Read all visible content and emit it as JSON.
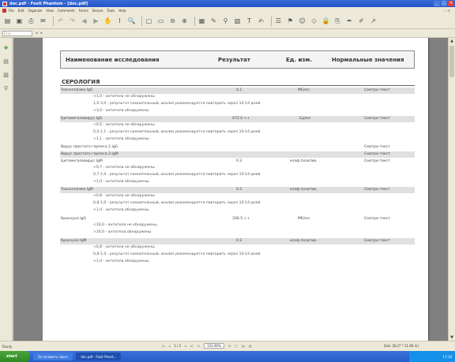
{
  "window": {
    "title": "doc.pdf - Foxit Phantom - [doc.pdf]"
  },
  "menu": {
    "items": [
      "File",
      "Edit",
      "Organize",
      "View",
      "Comments",
      "Forms",
      "Secure",
      "Tools",
      "Help"
    ],
    "right": "- ‹ ×"
  },
  "find": {
    "placeholder": "Find"
  },
  "table": {
    "headers": {
      "name": "Наименование исследования",
      "result": "Результат",
      "unit": "Ед. изм.",
      "norm": "Нормальные значения"
    },
    "section": "СЕРОЛОГИЯ",
    "rows": [
      {
        "name": "Токсоплазма IgG",
        "result": "0.1",
        "unit": "МЕ/мл",
        "norm": "Смотри текст"
      },
      {
        "name": "Цитомегаловирус IgG",
        "result": "472.0 ++",
        "unit": "Ед/мл",
        "norm": "Смотри текст"
      },
      {
        "name": "Вирус простого герпеса 2 IgG",
        "result": "",
        "unit": "",
        "norm": "Смотри текст"
      },
      {
        "name": "Вирус простого герпеса 2 IgM",
        "result": "",
        "unit": "",
        "norm": "Смотри текст"
      },
      {
        "name": "Цитомегаловирус IgM",
        "result": "0.3",
        "unit": "коэф.позитив.",
        "norm": "Смотри текст"
      },
      {
        "name": "Токсоплазма IgM",
        "result": "0.2",
        "unit": "коэф.позитив.",
        "norm": "Смотри текст"
      },
      {
        "name": "Краснуха IgG",
        "result": "336.5 ++",
        "unit": "МЕ/мл",
        "norm": "Смотри текст"
      },
      {
        "name": "Краснуха IgM",
        "result": "0.2",
        "unit": "коэф.позитив.",
        "norm": "Смотри текст"
      }
    ],
    "notes": {
      "toxo_igg": [
        "<1,0  - антитела не обнаружены",
        "1,0-3,0 - результат сомнительный, анализ рекомендуется повторить через 10-14 дней",
        ">3,0 - антитела обнаружены"
      ],
      "cmv_igg": [
        "<0,5    - антитела не обнаружены",
        "0,5-1,1  - результат сомнительный, анализ рекомендуется повторить через 10-14 дней",
        ">1,1    - антитела обнаружены"
      ],
      "cmv_igm": [
        "<0,7    - антитела не обнаружены",
        "0,7-1,0  - результат сомнительный, анализ рекомендуется повторить через 10-14 дней",
        ">1,0    - антитела обнаружены"
      ],
      "toxo_igm": [
        "<0,8    - антитела не обнаружены",
        "0,8-1,0  - результат сомнительный, анализ рекомендуется повторить через 10-14 дней",
        ">1,0    - антитела обнаружены"
      ],
      "rub_igg": [
        "<10,0    - антитела не обнаружены",
        ">10,0    - антитела обнаружены"
      ],
      "rub_igm": [
        "<0,8    - антитела не обнаружены",
        "0,8-1,0  - результат сомнительный, анализ рекомендуется повторить через 10-14 дней",
        ">1,0    - антитела обнаружены"
      ]
    }
  },
  "status": {
    "ready": "Ready",
    "page": "1 / 1",
    "zoom": "152.90%",
    "size": "Size: [8.27 * 11.69 in]"
  },
  "taskbar": {
    "start": "start",
    "tasks": [
      "Остановить пакет",
      "doc.pdf - Foxit Phant..."
    ],
    "clock": "17:18"
  }
}
